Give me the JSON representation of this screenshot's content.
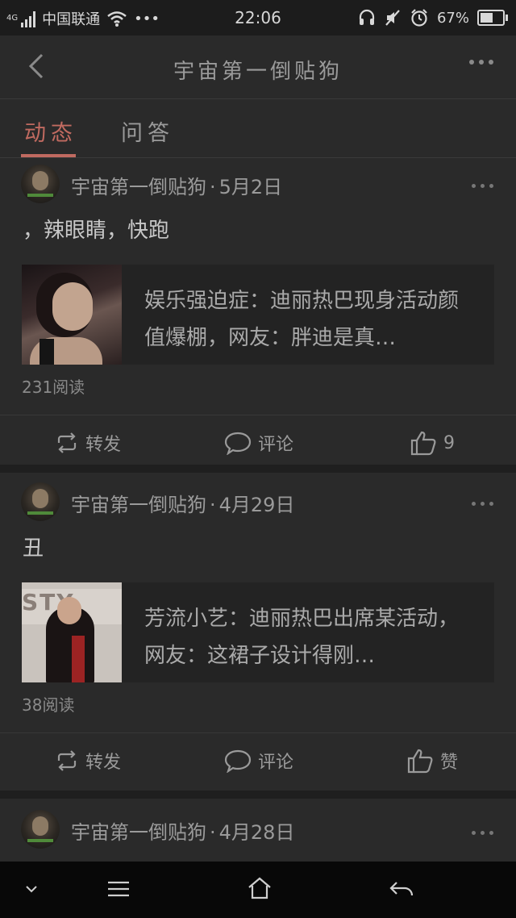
{
  "status_bar": {
    "network": "4G",
    "carrier": "中国联通",
    "more": "•••",
    "time": "22:06",
    "battery": "67%",
    "battery_level": 0.67
  },
  "header": {
    "title": "宇宙第一倒贴狗"
  },
  "tabs": [
    {
      "label": "动态",
      "active": true
    },
    {
      "label": "问答",
      "active": false
    }
  ],
  "posts": [
    {
      "author": "宇宙第一倒贴狗",
      "date": "5月2日",
      "text": "，辣眼睛，快跑",
      "link_title": "娱乐强迫症：迪丽热巴现身活动颜值爆棚，网友：胖迪是真…",
      "reads": "231阅读",
      "repost": "转发",
      "comment": "评论",
      "like": "9"
    },
    {
      "author": "宇宙第一倒贴狗",
      "date": "4月29日",
      "text": "丑",
      "link_title": "芳流小艺：迪丽热巴出席某活动，网友：这裙子设计得刚…",
      "thumb_sign": "STY",
      "reads": "38阅读",
      "repost": "转发",
      "comment": "评论",
      "like": "赞"
    },
    {
      "author": "宇宙第一倒贴狗",
      "date": "4月28日"
    }
  ],
  "separator": "·",
  "colors": {
    "accent": "#c06a60",
    "background": "#2a2a2a",
    "text": "#9a9a9a"
  },
  "icons": [
    "back-icon",
    "more-icon",
    "repost-icon",
    "comment-icon",
    "like-icon",
    "chevron-down-icon",
    "menu-icon",
    "home-icon",
    "return-icon"
  ]
}
